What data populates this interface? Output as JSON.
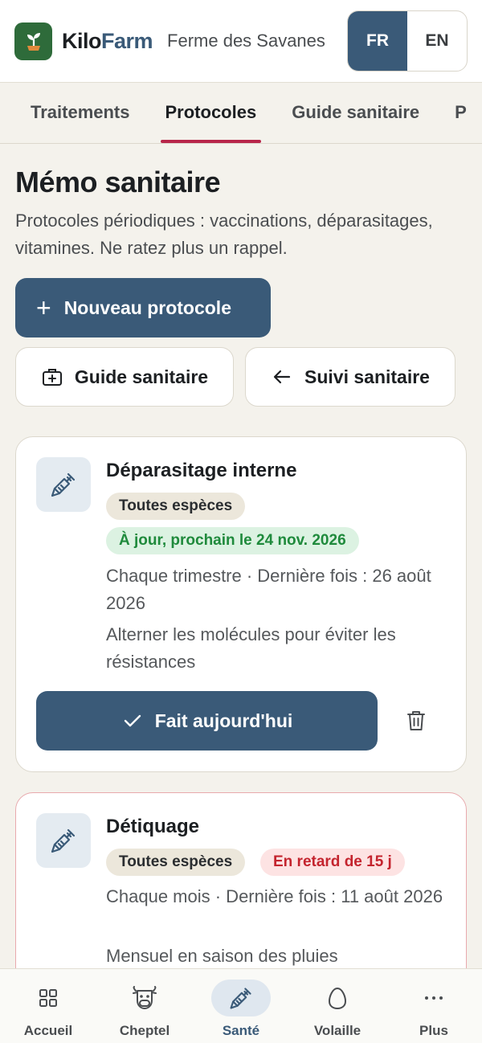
{
  "header": {
    "brand_kilo": "Kilo",
    "brand_farm": "Farm",
    "farm_name": "Ferme des Savanes",
    "lang": {
      "fr": "FR",
      "en": "EN",
      "active": "FR"
    }
  },
  "tabs": [
    {
      "label": "Traitements",
      "active": false
    },
    {
      "label": "Protocoles",
      "active": true
    },
    {
      "label": "Guide sanitaire",
      "active": false
    },
    {
      "label": "P",
      "active": false
    }
  ],
  "main": {
    "title": "Mémo sanitaire",
    "subtitle": "Protocoles périodiques : vaccinations, déparasitages, vitamines. Ne ratez plus un rappel.",
    "new_protocol": "Nouveau protocole",
    "guide_button": "Guide sanitaire",
    "back_button": "Suivi sanitaire"
  },
  "cards": [
    {
      "title": "Déparasitage interne",
      "species": "Toutes espèces",
      "status": "À jour, prochain le 24 nov. 2026",
      "status_type": "ok",
      "schedule": "Chaque trimestre · Dernière fois : 26 août 2026",
      "note": "Alterner les molécules pour éviter les résistances",
      "done_label": "Fait aujourd'hui"
    },
    {
      "title": "Détiquage",
      "species": "Toutes espèces",
      "status": "En retard de 15 j",
      "status_type": "late",
      "schedule": "Chaque mois · Dernière fois : 11 août 2026",
      "note": "Mensuel en saison des pluies"
    }
  ],
  "bottom_nav": [
    {
      "label": "Accueil",
      "icon": "grid-icon",
      "active": false
    },
    {
      "label": "Cheptel",
      "icon": "cow-icon",
      "active": false
    },
    {
      "label": "Santé",
      "icon": "syringe-icon",
      "active": true
    },
    {
      "label": "Volaille",
      "icon": "egg-icon",
      "active": false
    },
    {
      "label": "Plus",
      "icon": "more-icon",
      "active": false
    }
  ],
  "colors": {
    "primary": "#3a5a78",
    "accent_tab": "#b8264a",
    "ok_text": "#1f8a3c",
    "late_text": "#c4242e",
    "background": "#f4f2ec"
  }
}
